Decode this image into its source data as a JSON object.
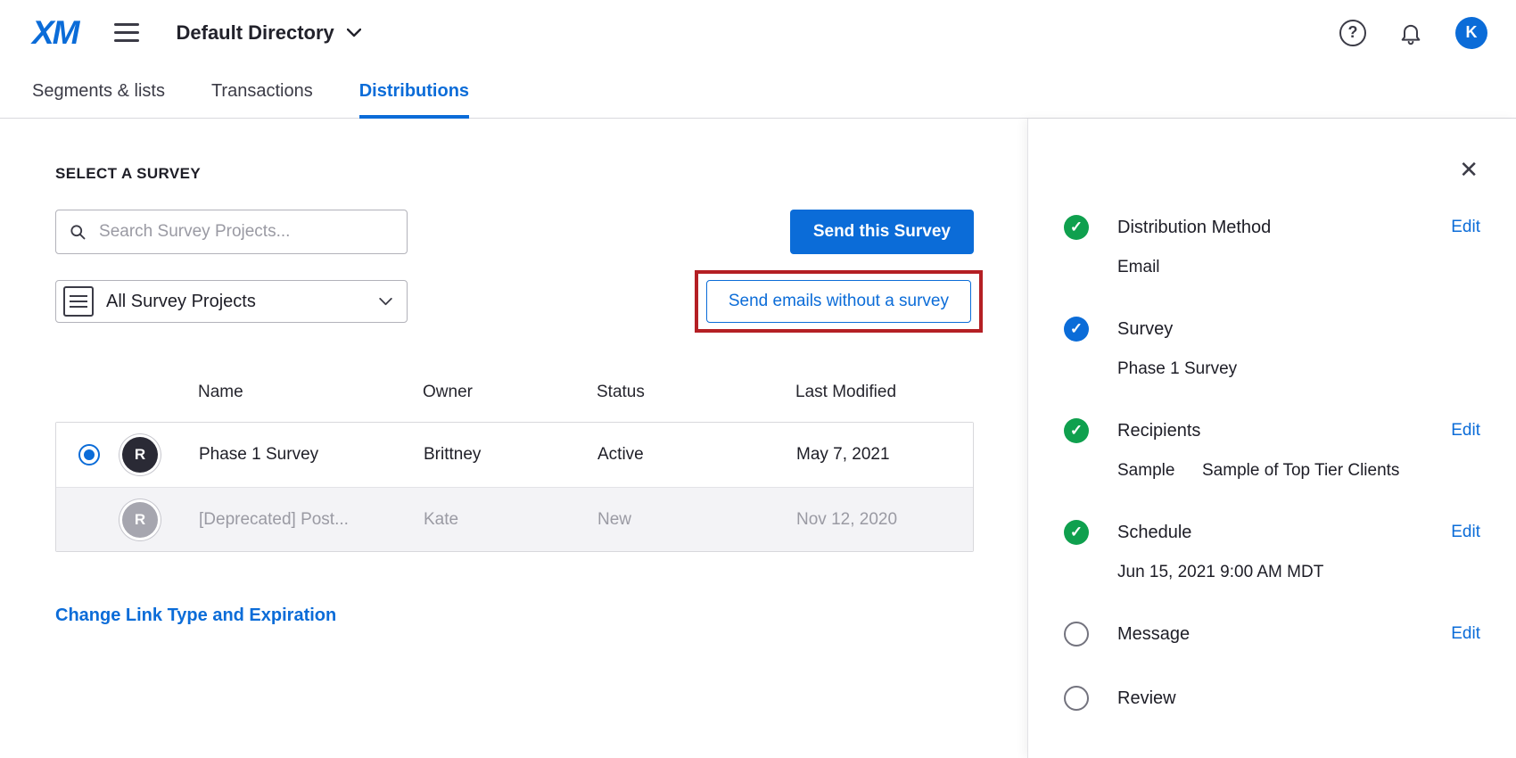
{
  "header": {
    "logo": "XM",
    "directory_label": "Default Directory",
    "help_glyph": "?",
    "avatar_initial": "K"
  },
  "tabs": [
    {
      "label": "Segments & lists",
      "active": false
    },
    {
      "label": "Transactions",
      "active": false
    },
    {
      "label": "Distributions",
      "active": true
    }
  ],
  "main": {
    "section_title": "SELECT A SURVEY",
    "search_placeholder": "Search Survey Projects...",
    "filter_dropdown_value": "All Survey Projects",
    "send_survey_button": "Send this Survey",
    "send_emails_button": "Send emails without a survey",
    "table": {
      "columns": {
        "name": "Name",
        "owner": "Owner",
        "status": "Status",
        "last_modified": "Last Modified"
      },
      "rows": [
        {
          "avatar": "R",
          "name": "Phase 1 Survey",
          "owner": "Brittney",
          "status": "Active",
          "last_modified": "May 7, 2021",
          "selected": true,
          "disabled": false
        },
        {
          "avatar": "R",
          "name": "[Deprecated] Post...",
          "owner": "Kate",
          "status": "New",
          "last_modified": "Nov 12, 2020",
          "selected": false,
          "disabled": true
        }
      ]
    },
    "change_link": "Change Link Type and Expiration"
  },
  "panel": {
    "close_glyph": "✕",
    "steps": [
      {
        "label": "Distribution Method",
        "state": "complete",
        "edit": "Edit",
        "detail": "Email"
      },
      {
        "label": "Survey",
        "state": "complete",
        "detail": "Phase 1 Survey"
      },
      {
        "label": "Recipients",
        "state": "complete",
        "edit": "Edit",
        "detail": "Sample",
        "detail2": "Sample of Top Tier Clients"
      },
      {
        "label": "Schedule",
        "state": "complete",
        "edit": "Edit",
        "detail": "Jun 15, 2021 9:00 AM MDT"
      },
      {
        "label": "Message",
        "state": "incomplete",
        "edit": "Edit"
      },
      {
        "label": "Review",
        "state": "incomplete"
      }
    ]
  },
  "colors": {
    "accent": "#0b6cd8",
    "success_green": "#0fa04e",
    "annotation_red": "#b41f24",
    "disabled_text": "#9a9aa3"
  }
}
